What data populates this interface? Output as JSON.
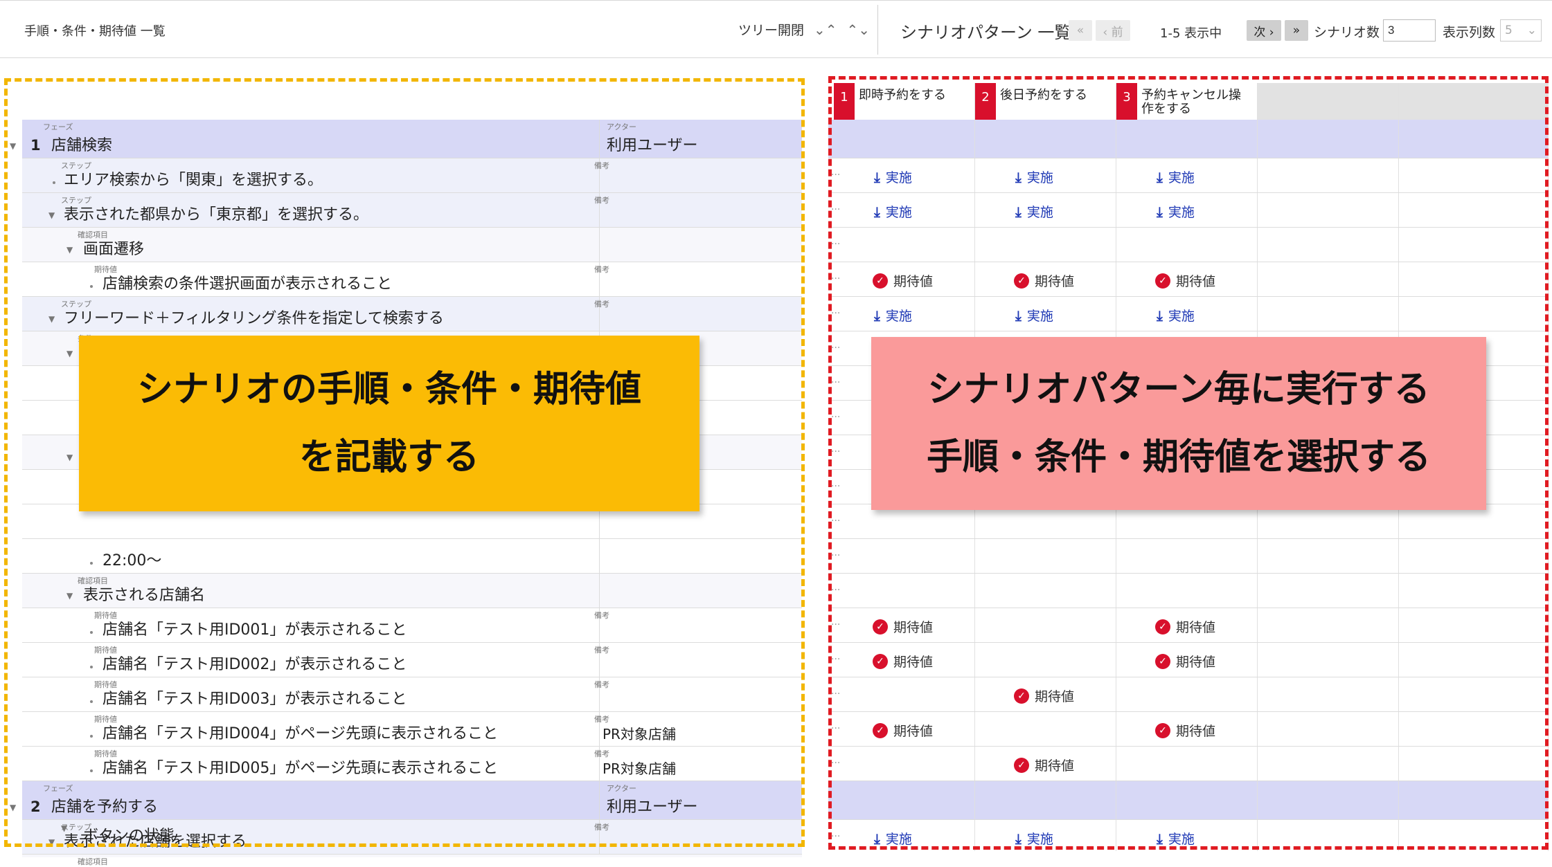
{
  "toolbar": {
    "title": "手順・条件・期待値 一覧",
    "tree_toggle_label": "ツリー開閉",
    "collapse_icon": "collapse-icon",
    "expand_icon": "expand-icon",
    "scenario_list_title": "シナリオパターン 一覧",
    "first_label": "«",
    "prev_label": "‹ 前",
    "page_info": "1-5 表示中",
    "next_label": "次 ›",
    "last_label": "»",
    "scenario_count_label": "シナリオ数",
    "scenario_count_value": "3",
    "column_count_label": "表示列数",
    "column_count_value": "5"
  },
  "labels": {
    "phase": "フェーズ",
    "actor": "アクター",
    "step": "ステップ",
    "note": "備考",
    "check_item": "確認項目",
    "expected": "期待値",
    "condition": "条件"
  },
  "rows": [
    {
      "type": "phase",
      "num": "1",
      "text": "店舗検索",
      "actor": "利用ユーザー"
    },
    {
      "type": "step",
      "text": "エリア検索から「関東」を選択する。",
      "note": ""
    },
    {
      "type": "step",
      "text": "表示された都県から「東京都」を選択する。",
      "note": ""
    },
    {
      "type": "check",
      "text": "画面遷移"
    },
    {
      "type": "exp",
      "text": "店舗検索の条件選択画面が表示されること",
      "note": ""
    },
    {
      "type": "step",
      "text": "フリーワード＋フィルタリング条件を指定して検索する",
      "note": ""
    },
    {
      "type": "cond",
      "text": "22:00〜"
    },
    {
      "type": "check",
      "text": "表示される店舗名"
    },
    {
      "type": "exp",
      "text": "店舗名「テスト用ID001」が表示されること",
      "note": ""
    },
    {
      "type": "exp",
      "text": "店舗名「テスト用ID002」が表示されること",
      "note": ""
    },
    {
      "type": "exp",
      "text": "店舗名「テスト用ID003」が表示されること",
      "note": ""
    },
    {
      "type": "exp",
      "text": "店舗名「テスト用ID004」がページ先頭に表示されること",
      "note": "PR対象店舗"
    },
    {
      "type": "exp",
      "text": "店舗名「テスト用ID005」がページ先頭に表示されること",
      "note": "PR対象店舗"
    },
    {
      "type": "phase",
      "num": "2",
      "text": "店舗を予約する",
      "actor": "利用ユーザー"
    },
    {
      "type": "step",
      "text": "表示された店舗を選択する",
      "note": ""
    },
    {
      "type": "check",
      "text": "ボタンの状態"
    }
  ],
  "scenarios": [
    {
      "num": "1",
      "name": "即時予約をする"
    },
    {
      "num": "2",
      "name": "後日予約をする"
    },
    {
      "num": "3",
      "name": "予約キャンセル操作をする"
    }
  ],
  "marks": {
    "exec_label": "実施",
    "exp_label": "期待値",
    "exec_icon": "down-arrow-icon",
    "exp_icon": "check-circle-icon"
  },
  "callouts": {
    "left_line1": "シナリオの手順・条件・期待値",
    "left_line2": "を記載する",
    "right_line1": "シナリオパターン毎に実行する",
    "right_line2": "手順・条件・期待値を選択する"
  },
  "colors": {
    "phase_bg": "#d7d8f6",
    "scenario_badge": "#d8102c",
    "exec_text": "#1f39b5",
    "left_frame": "#f2b600",
    "right_frame": "#e01b22",
    "left_callout": "#fbbb05",
    "right_callout": "#fa9a9a"
  }
}
